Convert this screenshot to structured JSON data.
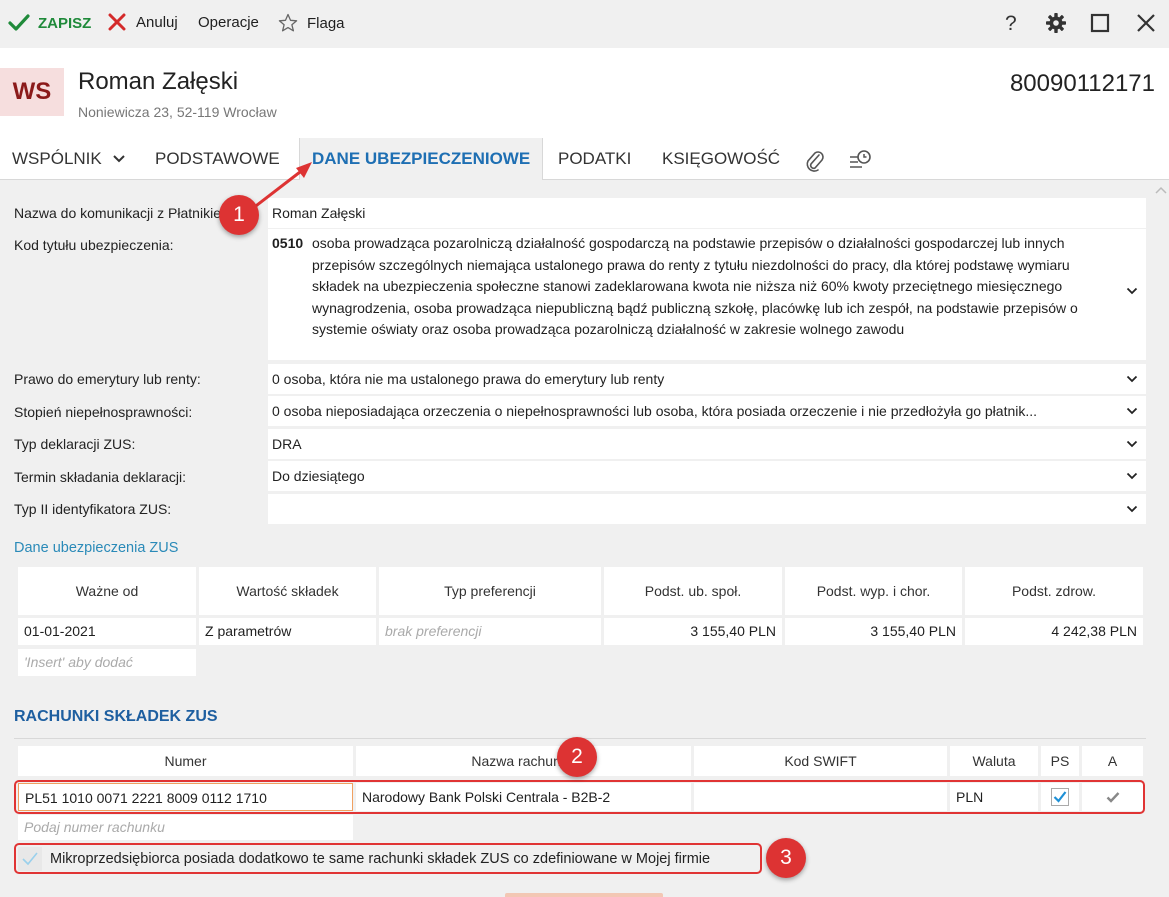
{
  "toolbar": {
    "save_label": "ZAPISZ",
    "cancel_label": "Anuluj",
    "operations_label": "Operacje",
    "flag_label": "Flaga",
    "help_label": "?"
  },
  "header": {
    "avatar_initials": "WS",
    "name": "Roman Załęski",
    "address": "Noniewicza 23, 52-119 Wrocław",
    "pesel": "80090112171"
  },
  "tabs": [
    {
      "label": "WSPÓLNIK"
    },
    {
      "label": "PODSTAWOWE"
    },
    {
      "label": "DANE UBEZPIECZENIOWE"
    },
    {
      "label": "PODATKI"
    },
    {
      "label": "KSIĘGOWOŚĆ"
    }
  ],
  "form": {
    "comm_name_label": "Nazwa do komunikacji z Płatnikiem:",
    "comm_name_value": "Roman Załęski",
    "insurance_code_label": "Kod tytułu ubezpieczenia:",
    "insurance_code": "0510",
    "insurance_code_desc": "osoba prowadząca pozarolniczą działalność gospodarczą na podstawie przepisów o działalności gospodarczej lub innych przepisów szczególnych niemająca ustalonego prawa do renty z tytułu niezdolności do pracy, dla której podstawę wymiaru składek na ubezpieczenia społeczne stanowi zadeklarowana kwota nie niższa niż 60% kwoty przeciętnego miesięcznego wynagrodzenia, osoba prowadząca niepubliczną bądź publiczną szkołę, placówkę lub ich zespół, na podstawie przepisów o systemie oświaty oraz osoba prowadząca pozarolniczą działalność w zakresie wolnego zawodu",
    "pension_label": "Prawo do emerytury lub renty:",
    "pension_value": "0  osoba, która nie ma ustalonego prawa do emerytury lub renty",
    "disability_label": "Stopień niepełnosprawności:",
    "disability_value": "0  osoba nieposiadająca orzeczenia o niepełnosprawności lub osoba, która posiada orzeczenie i nie przedłożyła go płatnik...",
    "decl_type_label": "Typ deklaracji ZUS:",
    "decl_type_value": "DRA",
    "deadline_label": "Termin składania deklaracji:",
    "deadline_value": "Do dziesiątego",
    "id2_label": "Typ II identyfikatora ZUS:",
    "id2_value": ""
  },
  "zus_data": {
    "title": "Dane ubezpieczenia ZUS",
    "columns": [
      "Ważne od",
      "Wartość składek",
      "Typ preferencji",
      "Podst. ub. społ.",
      "Podst. wyp. i chor.",
      "Podst. zdrow."
    ],
    "row": [
      "01-01-2021",
      "Z parametrów",
      "brak preferencji",
      "3 155,40 PLN",
      "3 155,40 PLN",
      "4 242,38 PLN"
    ],
    "insert_hint": "'Insert' aby dodać"
  },
  "accounts": {
    "title": "RACHUNKI SKŁADEK ZUS",
    "columns": [
      "Numer",
      "Nazwa rachunku",
      "Kod SWIFT",
      "Waluta",
      "PS",
      "A"
    ],
    "row": {
      "number": "PL51 1010 0071 2221 8009 0112 1710",
      "name": "Narodowy Bank Polski Centrala - B2B-2",
      "swift": "",
      "currency": "PLN"
    },
    "number_placeholder": "Podaj numer rachunku",
    "same_accounts_label": "Mikroprzedsiębiorca posiada dodatkowo te same rachunki składek ZUS co zdefiniowane w Mojej firmie"
  },
  "badges": [
    "1",
    "2",
    "3"
  ],
  "colors": {
    "accent": "#1e6fb3",
    "save_green": "#1f8a3a",
    "annotation_red": "#dd3333"
  }
}
